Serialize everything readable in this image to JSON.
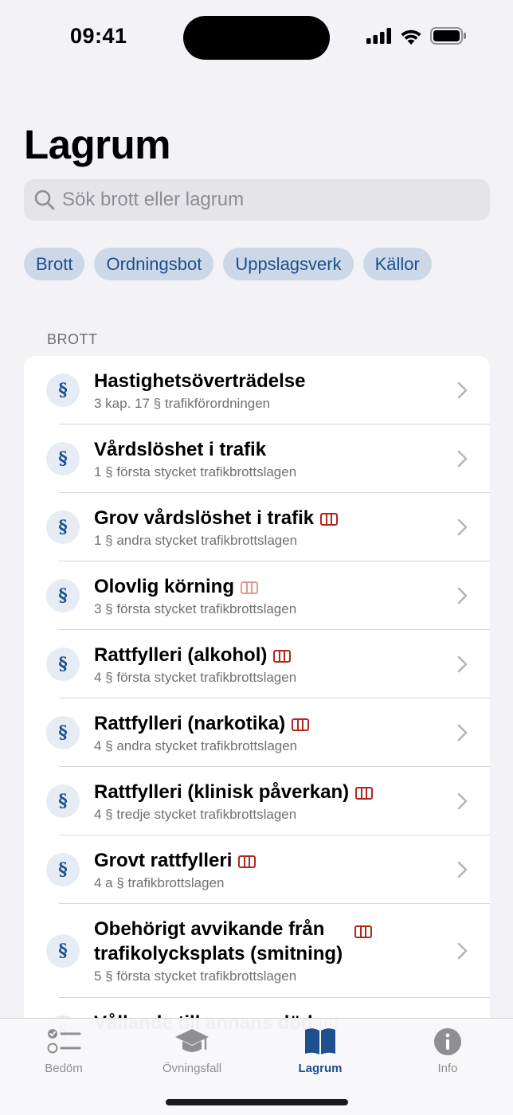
{
  "status_bar": {
    "time": "09:41"
  },
  "header": {
    "title": "Lagrum"
  },
  "search": {
    "placeholder": "Sök brott eller lagrum"
  },
  "chips": [
    {
      "label": "Brott"
    },
    {
      "label": "Ordningsbot"
    },
    {
      "label": "Uppslagsverk"
    },
    {
      "label": "Källor"
    }
  ],
  "section": {
    "header": "BROTT"
  },
  "icons": {
    "row_symbol": "§",
    "badge_icon": "prison-bars-icon",
    "chevron_icon": "chevron-right-icon"
  },
  "colors": {
    "accent": "#1e4f8f",
    "badge": "#b3261e",
    "badge_light": "#e09a93"
  },
  "rows": [
    {
      "title": "Hastighetsöverträdelse",
      "subtitle": "3 kap. 17 § trafikförordningen",
      "badge": "none"
    },
    {
      "title": "Vårdslöshet i trafik",
      "subtitle": "1 § första stycket trafikbrottslagen",
      "badge": "none"
    },
    {
      "title": "Grov vårdslöshet i trafik",
      "subtitle": "1 § andra stycket trafikbrottslagen",
      "badge": "prison"
    },
    {
      "title": "Olovlig körning",
      "subtitle": "3 § första stycket trafikbrottslagen",
      "badge": "prison-light"
    },
    {
      "title": "Rattfylleri (alkohol)",
      "subtitle": "4 § första stycket trafikbrottslagen",
      "badge": "prison"
    },
    {
      "title": "Rattfylleri (narkotika)",
      "subtitle": "4 § andra stycket trafikbrottslagen",
      "badge": "prison"
    },
    {
      "title": "Rattfylleri (klinisk påverkan)",
      "subtitle": "4 § tredje stycket trafikbrottslagen",
      "badge": "prison"
    },
    {
      "title": "Grovt rattfylleri",
      "subtitle": "4 a § trafikbrottslagen",
      "badge": "prison"
    },
    {
      "title": "Obehörigt avvikande från trafikolycksplats (smitning)",
      "subtitle": "5 § första stycket trafikbrottslagen",
      "badge": "prison"
    },
    {
      "title": "Vållande till annans död",
      "subtitle": "",
      "badge": "prison"
    }
  ],
  "tab_bar": {
    "tabs": [
      {
        "label": "Bedöm",
        "icon": "checklist-icon"
      },
      {
        "label": "Övningsfall",
        "icon": "graduation-cap-icon"
      },
      {
        "label": "Lagrum",
        "icon": "book-icon",
        "active": true
      },
      {
        "label": "Info",
        "icon": "info-icon"
      }
    ]
  }
}
